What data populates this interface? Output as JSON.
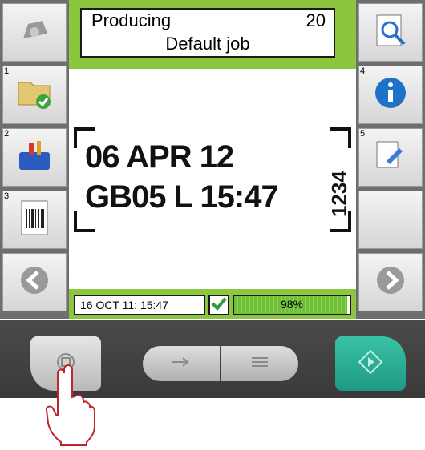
{
  "header": {
    "status": "Producing",
    "count": "20",
    "job_name": "Default job"
  },
  "left_buttons": [
    {
      "number": "",
      "icon": "printer-head-icon"
    },
    {
      "number": "1",
      "icon": "folder-check-icon"
    },
    {
      "number": "2",
      "icon": "toolbox-icon"
    },
    {
      "number": "3",
      "icon": "barcode-document-icon"
    },
    {
      "number": "",
      "icon": "arrow-left-icon"
    }
  ],
  "right_buttons": [
    {
      "number": "",
      "icon": "print-preview-icon"
    },
    {
      "number": "4",
      "icon": "info-icon"
    },
    {
      "number": "5",
      "icon": "settings-document-icon"
    },
    {
      "number": "",
      "icon": "blank-button"
    },
    {
      "number": "",
      "icon": "arrow-right-icon"
    }
  ],
  "label_preview": {
    "line1": "06 APR 12",
    "line2": "GB05 L 15:47",
    "vertical": "1234"
  },
  "status_bar": {
    "datetime": "16 OCT 11: 15:47",
    "ink_level_text": "98%",
    "ink_level": 0.98
  },
  "colors": {
    "frame_green": "#8cc63f",
    "start_teal": "#2bb196",
    "info_blue": "#1e73c8"
  }
}
